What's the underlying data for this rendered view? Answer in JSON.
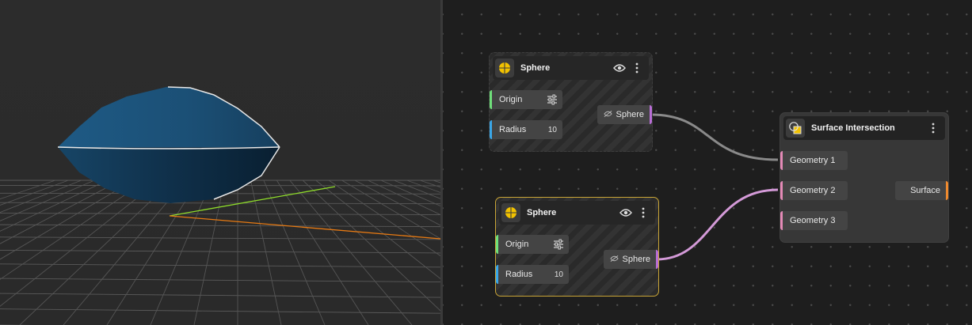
{
  "viewport": {
    "object_color": "#1b4d73",
    "axis_x_color": "#e87a12",
    "axis_y_color": "#8fdc2a"
  },
  "nodes": [
    {
      "title": "Sphere",
      "inputs": [
        {
          "label": "Origin",
          "type_color": "#6fe07a"
        },
        {
          "label": "Radius",
          "value": "10",
          "type_color": "#3aa7e8"
        }
      ],
      "output": {
        "label": "Sphere",
        "type_color": "#b96ed6"
      }
    },
    {
      "title": "Sphere",
      "selected": true,
      "inputs": [
        {
          "label": "Origin",
          "type_color": "#6fe07a"
        },
        {
          "label": "Radius",
          "value": "10",
          "type_color": "#3aa7e8"
        }
      ],
      "output": {
        "label": "Sphere",
        "type_color": "#b96ed6"
      }
    },
    {
      "title": "Surface Intersection",
      "inputs": [
        {
          "label": "Geometry 1",
          "type_color": "#e58ab7"
        },
        {
          "label": "Geometry 2",
          "type_color": "#e58ab7"
        },
        {
          "label": "Geometry 3",
          "type_color": "#e58ab7"
        }
      ],
      "output": {
        "label": "Surface",
        "type_color": "#ef8a2e"
      }
    }
  ],
  "wires": [
    {
      "from": "nodes.0.output",
      "to": "nodes.2.inputs.0",
      "color": "#8a8a8a"
    },
    {
      "from": "nodes.1.output",
      "to": "nodes.2.inputs.1",
      "color": "#d49ad8"
    }
  ],
  "colors": {
    "selected_border": "#c9a536",
    "sphere_icon": "#f2c200"
  },
  "icons": {
    "visibility": "eye-icon",
    "menu": "more-vertical-icon",
    "origin_control": "sliders-icon",
    "output_hidden": "eye-off-icon"
  }
}
